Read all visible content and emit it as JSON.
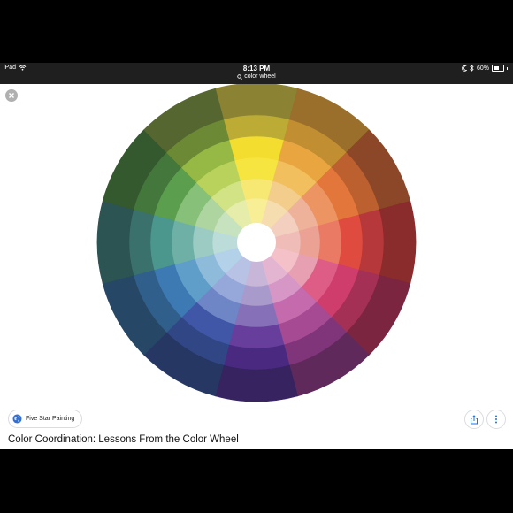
{
  "status_bar": {
    "device": "iPad",
    "time": "8:13 PM",
    "battery": "60%",
    "battery_level": 0.6,
    "icons": [
      "wifi-icon",
      "moon-icon",
      "bluetooth-icon",
      "battery-icon"
    ]
  },
  "address_bar": {
    "query": "color wheel",
    "icon": "search-icon"
  },
  "image_viewer": {
    "close_icon": "close-icon",
    "image_subject": "color-wheel",
    "colors": {
      "rings": [
        [
          "#f7ee96",
          "#f6ddb0",
          "#f3cfbf",
          "#f0bcb7",
          "#f4c1c9",
          "#e3b5d1",
          "#c8b6d9",
          "#b7c2e4",
          "#b3d2ea",
          "#bcdcd9",
          "#c6e2bf",
          "#e6ecaa"
        ],
        [
          "#f6e873",
          "#f3cd8c",
          "#eeb29a",
          "#eba294",
          "#e7a0b2",
          "#d696c6",
          "#a99acc",
          "#95a8d9",
          "#8fbbdb",
          "#9ccbc3",
          "#aed59f",
          "#d1e385"
        ],
        [
          "#f6e540",
          "#f1bf5d",
          "#ed9463",
          "#ea7a63",
          "#dd5d86",
          "#c56aad",
          "#8670b7",
          "#6e86c6",
          "#5f9ec9",
          "#6fb0a6",
          "#87c079",
          "#b8d25b"
        ],
        [
          "#f3dd2f",
          "#e9a640",
          "#e3763b",
          "#e04b3f",
          "#cf3d6d",
          "#a54a93",
          "#673e9b",
          "#3f57a6",
          "#3d79b3",
          "#4b978e",
          "#5b9e4d",
          "#96b844"
        ],
        [
          "#bcac36",
          "#c28e32",
          "#bc6030",
          "#b7383a",
          "#a43056",
          "#80357a",
          "#4a2a80",
          "#314785",
          "#305f8c",
          "#3a716d",
          "#44773c",
          "#6c8a35"
        ],
        [
          "#8c8233",
          "#9a6f2c",
          "#8b4728",
          "#8a2b2c",
          "#7b2540",
          "#5f2a5b",
          "#36235f",
          "#263763",
          "#264866",
          "#2b5453",
          "#34592f",
          "#556630"
        ]
      ]
    }
  },
  "result": {
    "source": "Five Star Painting",
    "source_icon": "globe-icon",
    "title": "Color Coordination: Lessons From the Color Wheel",
    "share_icon": "share-icon",
    "more_icon": "more-vertical-icon"
  }
}
